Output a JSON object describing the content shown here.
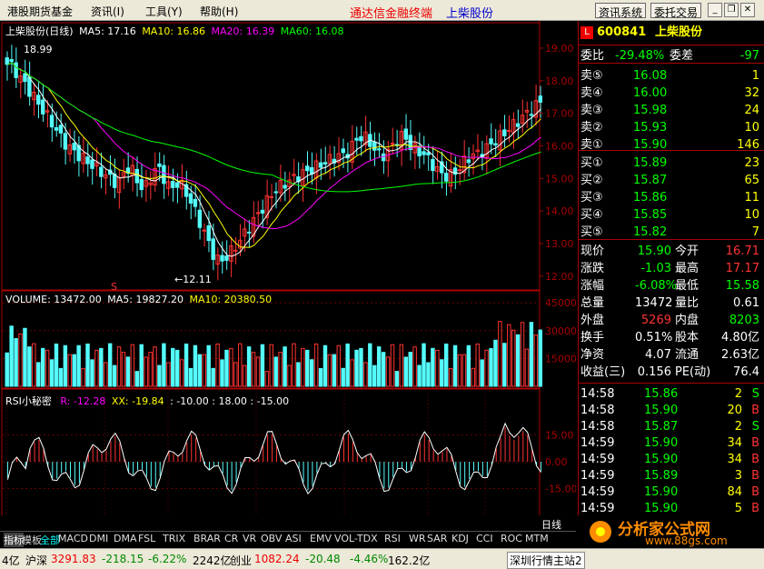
{
  "menu": {
    "items": [
      "港股期货基金",
      "资讯(I)",
      "工具(Y)",
      "帮助(H)"
    ],
    "title_red": "通达信金融终端",
    "title_blue": "上柴股份",
    "btn1": "资讯系统",
    "btn2": "委托交易"
  },
  "chart": {
    "header": {
      "name": "上柴股份(日线)",
      "ma5": "MA5: 17.16",
      "ma10": "MA10: 16.86",
      "ma20": "MA20: 16.39",
      "ma60": "MA60: 16.08"
    },
    "high_label": "18.99",
    "low_label": "←12.11",
    "s_marker": "S",
    "price_ticks": [
      "19.00",
      "18.00",
      "17.00",
      "16.00",
      "15.00",
      "14.00",
      "13.00",
      "12.00"
    ],
    "volume_header": {
      "v": "VOLUME: 13472.00",
      "ma5": "MA5: 19827.20",
      "ma10": "MA10: 20380.50"
    },
    "vol_ticks": [
      "45000",
      "30000",
      "15000"
    ],
    "rsi_header": {
      "name": "RSI小秘密",
      "r": "R: -12.28",
      "xx": "XX: -19.84",
      "rest": ": -10.00 : 18.00 : -15.00"
    },
    "rsi_ticks": [
      "15.00",
      "0.00",
      "-15.00"
    ],
    "date_labels": [
      "2010年",
      "6",
      "7",
      "8",
      "9",
      "10",
      "11"
    ],
    "period": "日线"
  },
  "quote": {
    "code": "600841",
    "name": "上柴股份",
    "ratio_label": "委比",
    "ratio": "-29.48%",
    "diff_label": "委差",
    "diff": "-97",
    "sells": [
      [
        "卖⑤",
        "16.08",
        "1"
      ],
      [
        "卖④",
        "16.00",
        "32"
      ],
      [
        "卖③",
        "15.98",
        "24"
      ],
      [
        "卖②",
        "15.93",
        "10"
      ],
      [
        "卖①",
        "15.90",
        "146"
      ]
    ],
    "buys": [
      [
        "买①",
        "15.89",
        "23"
      ],
      [
        "买②",
        "15.87",
        "65"
      ],
      [
        "买③",
        "15.86",
        "11"
      ],
      [
        "买④",
        "15.85",
        "10"
      ],
      [
        "买⑤",
        "15.82",
        "7"
      ]
    ],
    "stats": [
      [
        "现价",
        "15.90",
        "今开",
        "16.71"
      ],
      [
        "涨跌",
        "-1.03",
        "最高",
        "17.17"
      ],
      [
        "涨幅",
        "-6.08%",
        "最低",
        "15.58"
      ],
      [
        "总量",
        "13472",
        "量比",
        "0.61"
      ],
      [
        "外盘",
        "5269",
        "内盘",
        "8203"
      ],
      [
        "换手",
        "0.51%",
        "股本",
        "4.80亿"
      ],
      [
        "净资",
        "4.07",
        "流通",
        "2.63亿"
      ],
      [
        "收益(三)",
        "0.156",
        "PE(动)",
        "76.4"
      ]
    ],
    "ticks": [
      [
        "14:58",
        "15.86",
        "2",
        "S"
      ],
      [
        "14:58",
        "15.90",
        "20",
        "B"
      ],
      [
        "14:58",
        "15.87",
        "2",
        "S"
      ],
      [
        "14:59",
        "15.90",
        "34",
        "B"
      ],
      [
        "14:59",
        "15.90",
        "34",
        "B"
      ],
      [
        "14:59",
        "15.89",
        "3",
        "B"
      ],
      [
        "14:59",
        "15.90",
        "84",
        "B"
      ],
      [
        "14:59",
        "15.90",
        "5",
        "B"
      ]
    ]
  },
  "tabs": [
    "指标",
    "模板",
    "全部",
    "MACD",
    "DMI",
    "DMA",
    "FSL",
    "TRIX",
    "BRAR",
    "CR",
    "VR",
    "OBV",
    "ASI",
    "EMV",
    "VOL-TDX",
    "RSI",
    "WR",
    "SAR",
    "KDJ",
    "CCI",
    "ROC",
    "MTM"
  ],
  "status": {
    "a": "4亿",
    "b": "沪深",
    "c": "3291.83",
    "d": "-218.15",
    "e": "-6.22%",
    "f": "2242亿",
    "g": "创业",
    "h": "1082.24",
    "i": "-20.48",
    "j": "-4.46%",
    "k": "162.2亿",
    "l": "深圳行情主站2"
  },
  "logo": {
    "text": "分析家公式网",
    "url": "www.88gs.com"
  },
  "colors": {
    "up": "#ff3232",
    "down": "#54fcfc",
    "ma5": "#ffffff",
    "ma10": "#ffff00",
    "ma20": "#ff00ff",
    "ma60": "#00ff00"
  }
}
